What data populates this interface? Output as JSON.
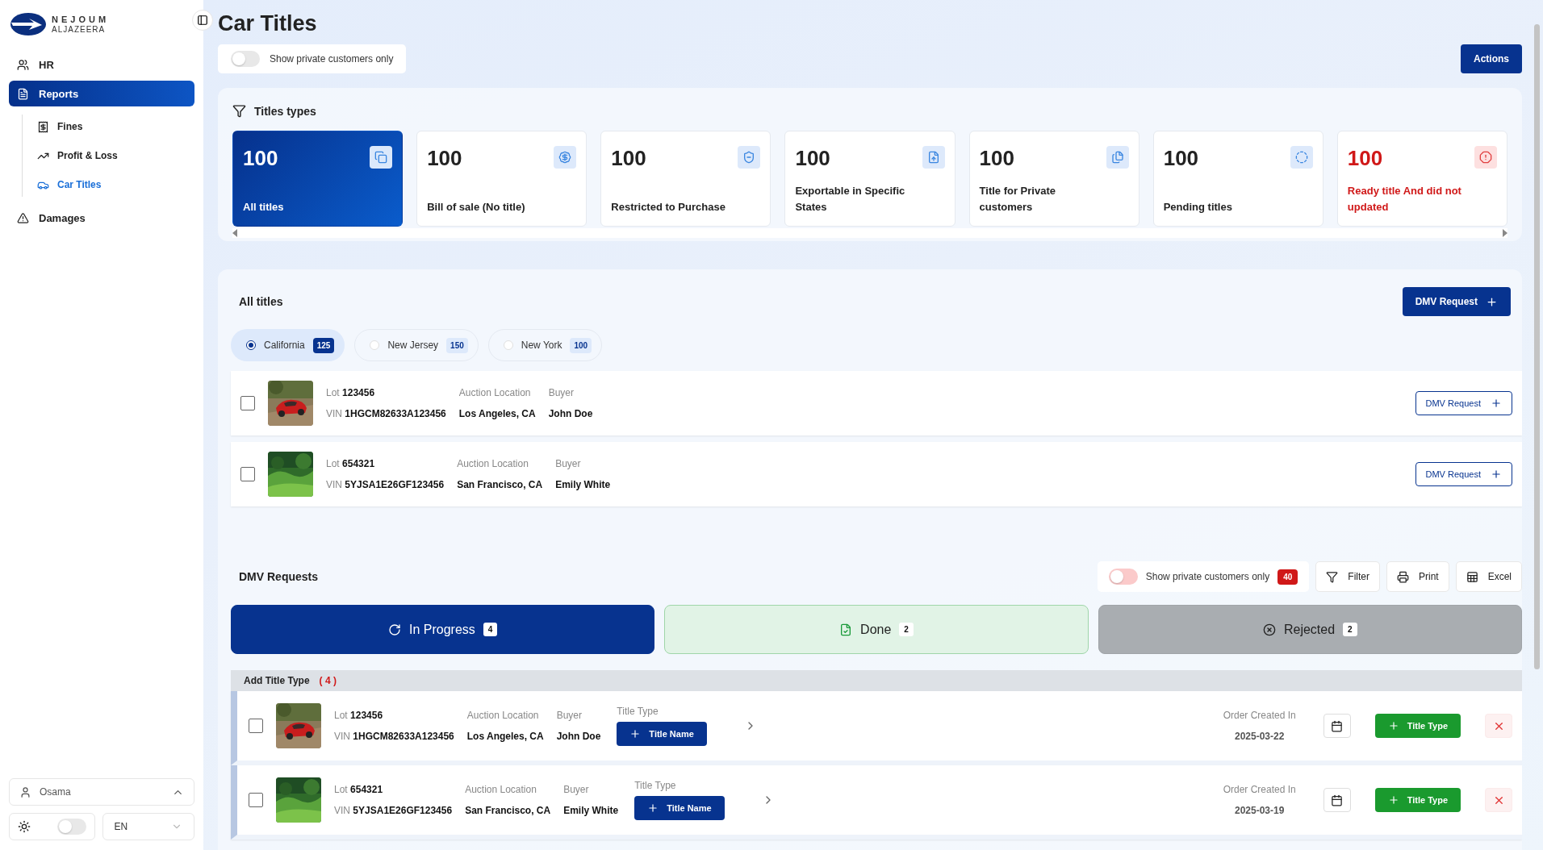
{
  "brand": {
    "name": "NEJOUM",
    "subtitle": "ALJAZEERA"
  },
  "sidebar": {
    "items": [
      {
        "label": "HR",
        "selected": false
      },
      {
        "label": "Reports",
        "selected": true,
        "children": [
          {
            "label": "Fines",
            "selected": false
          },
          {
            "label": "Profit & Loss",
            "selected": false
          },
          {
            "label": "Car Titles",
            "selected": true
          }
        ]
      },
      {
        "label": "Damages",
        "selected": false
      }
    ]
  },
  "user": {
    "name": "Osama"
  },
  "theme_toggle": {
    "on": false
  },
  "language": {
    "value": "EN"
  },
  "page": {
    "title": "Car Titles"
  },
  "private_filter": {
    "label": "Show private customers only",
    "on": false
  },
  "actions_button": "Actions",
  "title_types": {
    "heading": "Titles types",
    "cards": [
      {
        "count": "100",
        "label": "All titles",
        "selected": true,
        "alert": false
      },
      {
        "count": "100",
        "label": "Bill of sale (No title)",
        "selected": false,
        "alert": false
      },
      {
        "count": "100",
        "label": "Restricted to Purchase",
        "selected": false,
        "alert": false
      },
      {
        "count": "100",
        "label": "Exportable in Specific States",
        "selected": false,
        "alert": false
      },
      {
        "count": "100",
        "label": "Title for Private customers",
        "selected": false,
        "alert": false
      },
      {
        "count": "100",
        "label": "Pending titles",
        "selected": false,
        "alert": false
      },
      {
        "count": "100",
        "label": "Ready title And did not updated",
        "selected": false,
        "alert": true
      }
    ]
  },
  "all_titles": {
    "heading": "All titles",
    "dmv_button": "DMV Request",
    "states": [
      {
        "label": "California",
        "count": "125",
        "selected": true
      },
      {
        "label": "New Jersey",
        "count": "150",
        "selected": false
      },
      {
        "label": "New York",
        "count": "100",
        "selected": false
      }
    ],
    "rows": [
      {
        "checked": false,
        "lot_label": "Lot",
        "lot": "123456",
        "vin_label": "VIN",
        "vin": "1HGCM82633A123456",
        "location_label": "Auction Location",
        "location": "Los Angeles, CA",
        "buyer_label": "Buyer",
        "buyer": "John Doe",
        "button": "DMV Request"
      },
      {
        "checked": false,
        "lot_label": "Lot",
        "lot": "654321",
        "vin_label": "VIN",
        "vin": "5YJSA1E26GF123456",
        "location_label": "Auction Location",
        "location": "San Francisco, CA",
        "buyer_label": "Buyer",
        "buyer": "Emily White",
        "button": "DMV Request"
      }
    ]
  },
  "dmv_requests": {
    "heading": "DMV Requests",
    "private_filter": {
      "label": "Show private customers only",
      "on": false,
      "count": "40"
    },
    "tools": [
      {
        "label": "Filter",
        "kind": "filter"
      },
      {
        "label": "Print",
        "kind": "print"
      },
      {
        "label": "Excel",
        "kind": "excel"
      }
    ],
    "tabs": [
      {
        "label": "In Progress",
        "count": "4",
        "kind": "progress",
        "selected": true
      },
      {
        "label": "Done",
        "count": "2",
        "kind": "done",
        "selected": false
      },
      {
        "label": "Rejected",
        "count": "2",
        "kind": "rejected",
        "selected": false
      }
    ],
    "group": {
      "label": "Add Title Type",
      "count": "( 4 )"
    },
    "rows": [
      {
        "checked": false,
        "lot_label": "Lot",
        "lot": "123456",
        "vin_label": "VIN",
        "vin": "1HGCM82633A123456",
        "location_label": "Auction Location",
        "location": "Los Angeles, CA",
        "buyer_label": "Buyer",
        "buyer": "John Doe",
        "title_type_label": "Title Type",
        "title_button": "Title Name",
        "created_label": "Order Created In",
        "created": "2025-03-22",
        "add_button": "Title Type"
      },
      {
        "checked": false,
        "lot_label": "Lot",
        "lot": "654321",
        "vin_label": "VIN",
        "vin": "5YJSA1E26GF123456",
        "location_label": "Auction Location",
        "location": "San Francisco, CA",
        "buyer_label": "Buyer",
        "buyer": "Emily White",
        "title_type_label": "Title Type",
        "title_button": "Title Name",
        "created_label": "Order Created In",
        "created": "2025-03-19",
        "add_button": "Title Type"
      }
    ]
  }
}
